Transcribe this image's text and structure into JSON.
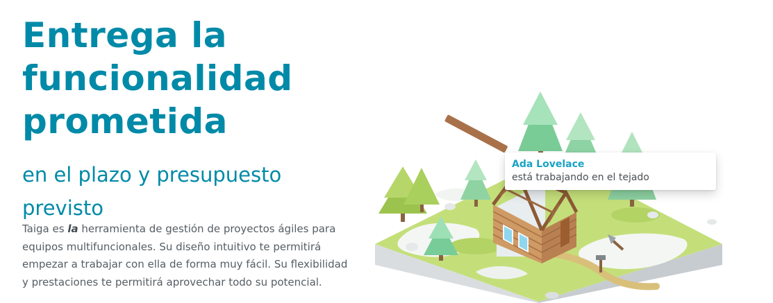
{
  "hero": {
    "title": "Entrega la funcionalidad prometida",
    "subtitle": "en el plazo y presupuesto previsto",
    "description": {
      "part1": "Taiga es ",
      "emphasis": "la",
      "part2": " herramienta de gestión de proyectos ágiles para equipos multifuncionales. Su diseño intuitivo te permitirá empezar a trabajar con ella de forma muy fácil. Su flexibilidad y prestaciones te permitirá aprovechar todo su potencial."
    }
  },
  "tooltip": {
    "name": "Ada Lovelace",
    "status": "está trabajando en el tejado"
  },
  "colors": {
    "primary": "#008aa8",
    "tooltip_name": "#1aa2c4",
    "body_text": "#555d63"
  }
}
